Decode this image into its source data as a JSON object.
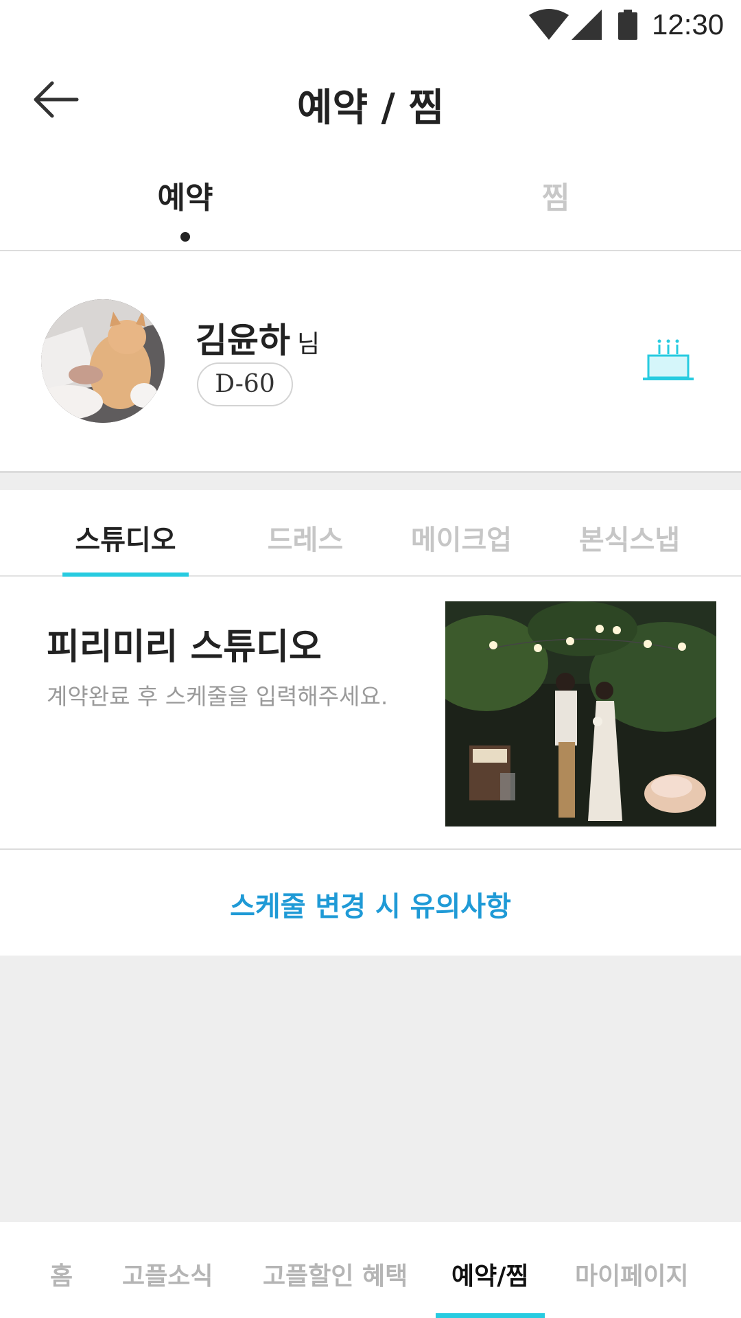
{
  "status_bar": {
    "time": "12:30",
    "icons": [
      "wifi-icon",
      "cell-signal-icon",
      "battery-icon"
    ]
  },
  "header": {
    "title": "예약 / 찜",
    "back_icon": "arrow-left-icon"
  },
  "top_tabs": [
    {
      "label": "예약",
      "active": true
    },
    {
      "label": "찜",
      "active": false
    }
  ],
  "profile": {
    "name": "김윤하",
    "suffix": "님",
    "dday": "D-60",
    "action_icon": "cake-icon"
  },
  "category_tabs": [
    {
      "label": "스튜디오",
      "active": true
    },
    {
      "label": "드레스",
      "active": false
    },
    {
      "label": "메이크업",
      "active": false
    },
    {
      "label": "본식스냅",
      "active": false
    }
  ],
  "vendor": {
    "name": "피리미리 스튜디오",
    "description": "계약완료 후 스케줄을 입력해주세요."
  },
  "notice_link": "스케줄 변경 시 유의사항",
  "bottom_nav": [
    {
      "label": "홈",
      "active": false
    },
    {
      "label": "고플소식",
      "active": false
    },
    {
      "label": "고플할인 혜택",
      "active": false
    },
    {
      "label": "예약/찜",
      "active": true
    },
    {
      "label": "마이페이지",
      "active": false
    }
  ],
  "colors": {
    "accent": "#27cbe0",
    "link": "#1f9ad6",
    "inactive_text": "#c6c6c6",
    "background_gray": "#eeeeee"
  }
}
